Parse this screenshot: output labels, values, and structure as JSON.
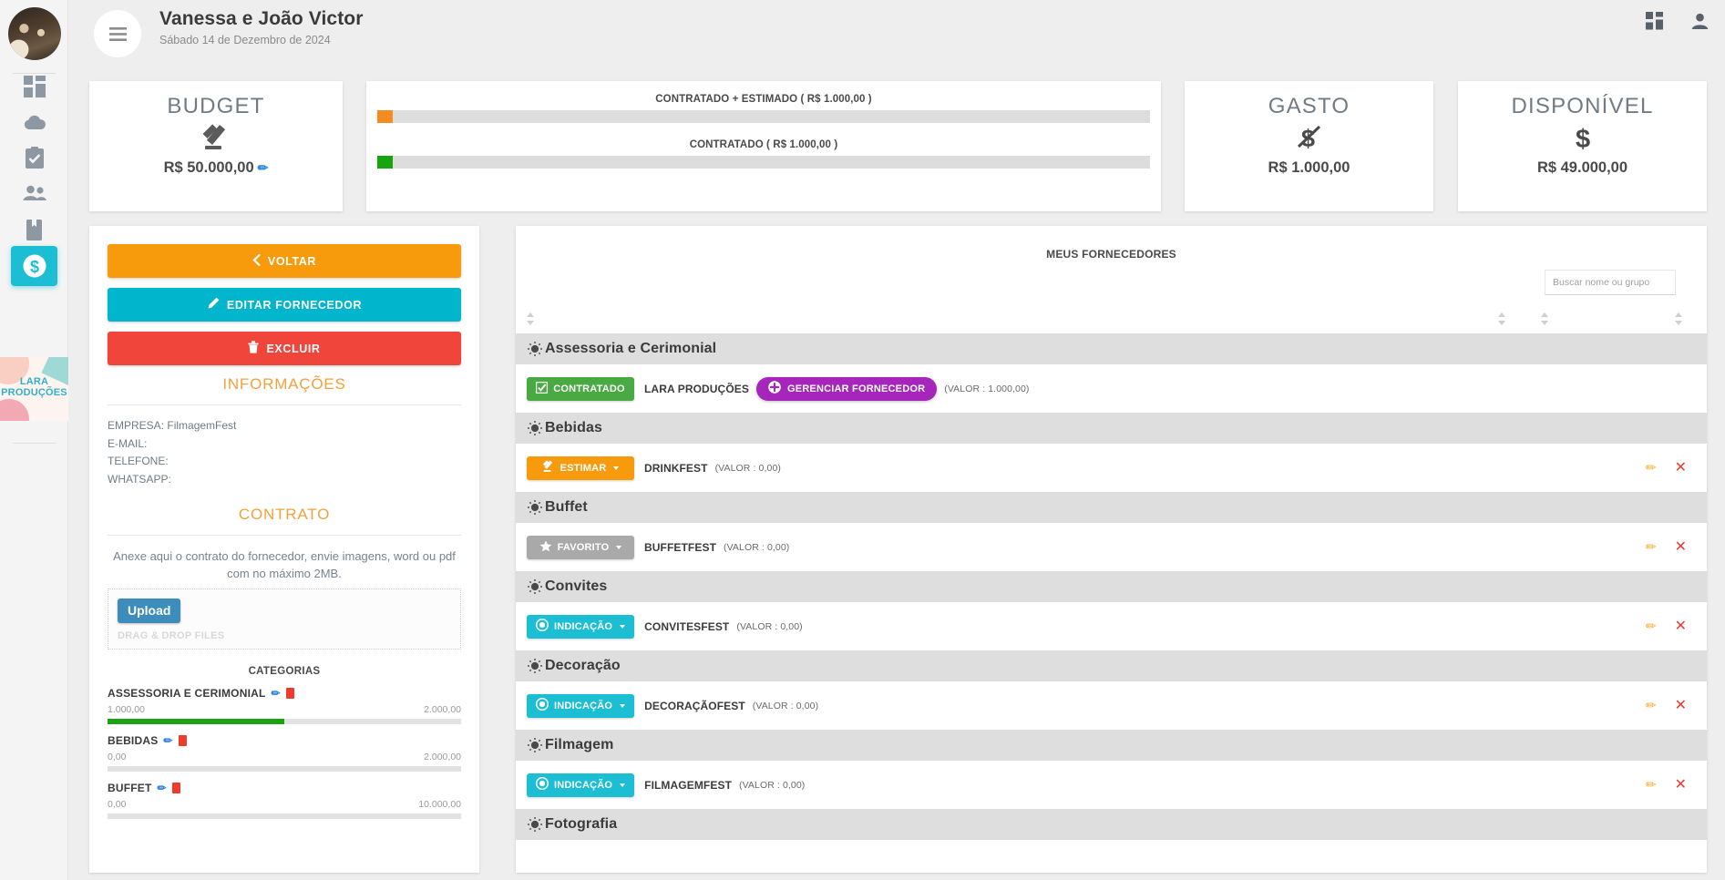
{
  "header": {
    "title": "Vanessa e João Victor",
    "subtitle": "Sábado 14 de Dezembro de 2024",
    "menu_icon": "hamburger-icon",
    "apps_icon": "grid-icon",
    "account_icon": "user-icon"
  },
  "sidebar": {
    "items": [
      {
        "icon": "dashboard-grid-icon",
        "active": false
      },
      {
        "icon": "cloud-download-icon",
        "active": false
      },
      {
        "icon": "clipboard-check-icon",
        "active": false
      },
      {
        "icon": "people-icon",
        "active": false
      },
      {
        "icon": "bookmark-book-icon",
        "active": false
      },
      {
        "icon": "dollar-circle-icon",
        "active": true
      }
    ],
    "logo_line1": "LARA",
    "logo_line2": "PRODUÇÕES"
  },
  "kpis": {
    "budget": {
      "title": "BUDGET",
      "icon": "gavel-icon",
      "value": "R$ 50.000,00",
      "edit_icon": "pencil-icon"
    },
    "gasto": {
      "title": "GASTO",
      "icon": "dollar-slash-icon",
      "value": "R$ 1.000,00"
    },
    "disponivel": {
      "title": "DISPONÍVEL",
      "icon": "dollar-sign-icon",
      "value": "R$ 49.000,00"
    }
  },
  "progress": {
    "bars": [
      {
        "label": "CONTRATADO + ESTIMADO ( R$ 1.000,00 )",
        "percent": 2,
        "color": "#f68c1f"
      },
      {
        "label": "CONTRATADO ( R$ 1.000,00 )",
        "percent": 2,
        "color": "#16a50c"
      }
    ]
  },
  "detail": {
    "buttons": [
      {
        "label": "VOLTAR",
        "icon": "chevron-left-icon",
        "color": "#f79b0d",
        "name": "back-button"
      },
      {
        "label": "EDITAR FORNECEDOR",
        "icon": "pencil-icon",
        "color": "#00b5cc",
        "name": "edit-vendor-button"
      },
      {
        "label": "EXCLUIR",
        "icon": "trash-icon",
        "color": "#f0453a",
        "name": "delete-vendor-button"
      }
    ],
    "info_title": "INFORMAÇÕES",
    "fields": [
      {
        "label": "EMPRESA:",
        "value": "FilmagemFest"
      },
      {
        "label": "E-MAIL:",
        "value": ""
      },
      {
        "label": "TELEFONE:",
        "value": ""
      },
      {
        "label": "WHATSAPP:",
        "value": ""
      }
    ],
    "contract_title": "CONTRATO",
    "contract_desc": "Anexe aqui o contrato do fornecedor, envie imagens, word ou pdf com no máximo 2MB.",
    "upload_label": "Upload",
    "drop_hint": "DRAG & DROP FILES",
    "categories_title": "CATEGORIAS",
    "categories": [
      {
        "name": "ASSESSORIA E CERIMONIAL",
        "current": "1.000,00",
        "max": "2.000,00",
        "percent": 50
      },
      {
        "name": "BEBIDAS",
        "current": "0,00",
        "max": "2.000,00",
        "percent": 0
      },
      {
        "name": "BUFFET",
        "current": "0,00",
        "max": "10.000,00",
        "percent": 0
      }
    ]
  },
  "vendors": {
    "title": "MEUS FORNECEDORES",
    "search_placeholder": "Buscar nome ou grupo",
    "search_value": "",
    "groups": [
      {
        "name": "Assessoria e Cerimonial",
        "items": [
          {
            "status": "CONTRATADO",
            "status_color": "#49a942",
            "status_icon": "check-square-icon",
            "has_caret": false,
            "vendor": "LARA PRODUÇÕES",
            "manage_label": "GERENCIAR FORNECEDOR",
            "manage_icon": "plus-circle-icon",
            "value": "(VALOR : 1.000,00)",
            "actions": false
          }
        ]
      },
      {
        "name": "Bebidas",
        "items": [
          {
            "status": "ESTIMAR",
            "status_color": "#f79b0d",
            "status_icon": "gavel-icon",
            "has_caret": true,
            "vendor": "DRINKFEST",
            "value": "(VALOR : 0,00)",
            "actions": true
          }
        ]
      },
      {
        "name": "Buffet",
        "items": [
          {
            "status": "FAVORITO",
            "status_color": "#a9a9a9",
            "status_icon": "star-icon",
            "has_caret": true,
            "vendor": "BUFFETFEST",
            "value": "(VALOR : 0,00)",
            "actions": true
          }
        ]
      },
      {
        "name": "Convites",
        "items": [
          {
            "status": "INDICAÇÃO",
            "status_color": "#1bbed3",
            "status_icon": "record-circle-icon",
            "has_caret": true,
            "vendor": "CONVITESFEST",
            "value": "(VALOR : 0,00)",
            "actions": true
          }
        ]
      },
      {
        "name": "Decoração",
        "items": [
          {
            "status": "INDICAÇÃO",
            "status_color": "#1bbed3",
            "status_icon": "record-circle-icon",
            "has_caret": true,
            "vendor": "DECORAÇÃOFEST",
            "value": "(VALOR : 0,00)",
            "actions": true
          }
        ]
      },
      {
        "name": "Filmagem",
        "items": [
          {
            "status": "INDICAÇÃO",
            "status_color": "#1bbed3",
            "status_icon": "record-circle-icon",
            "has_caret": true,
            "vendor": "FILMAGEMFEST",
            "value": "(VALOR : 0,00)",
            "actions": true
          }
        ]
      },
      {
        "name": "Fotografia",
        "items": []
      }
    ],
    "edit_icon": "pencil-icon",
    "remove_icon": "close-x-icon"
  }
}
